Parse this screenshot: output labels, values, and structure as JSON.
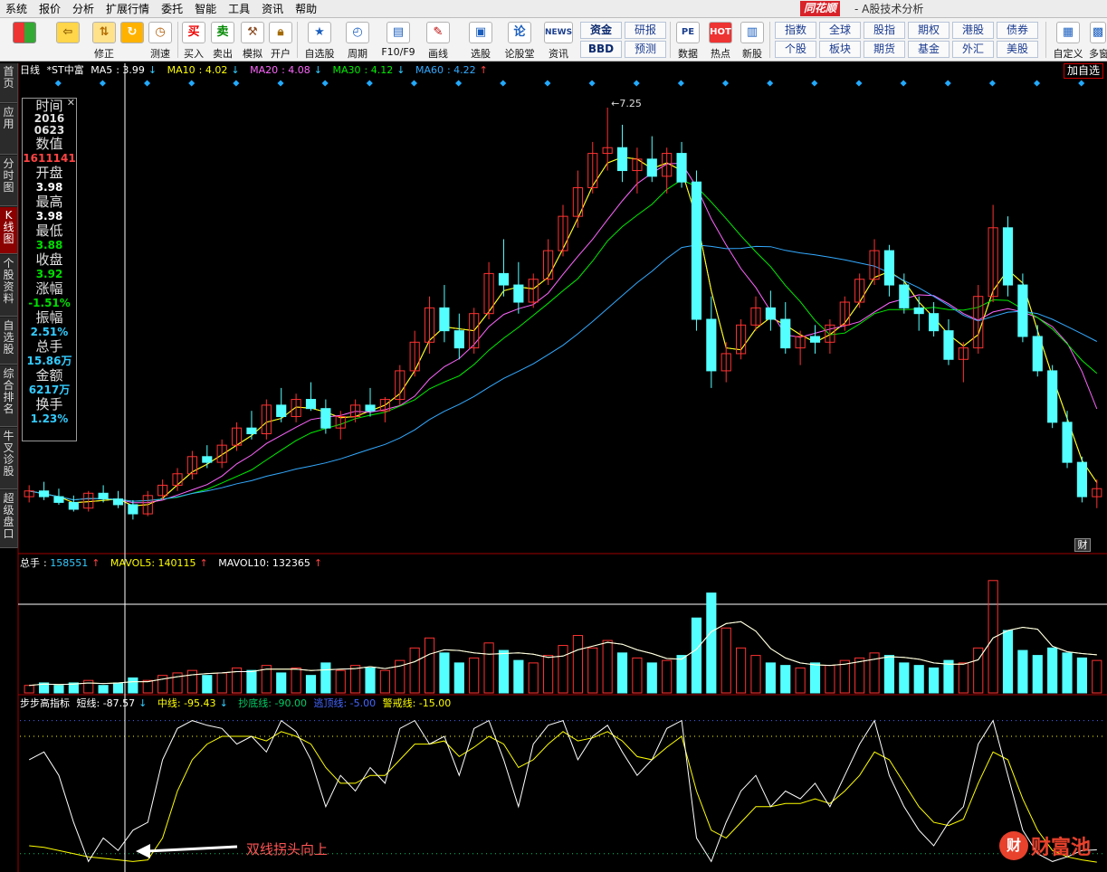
{
  "menubar": {
    "items": [
      "系统",
      "报价",
      "分析",
      "扩展行情",
      "委托",
      "智能",
      "工具",
      "资讯",
      "帮助"
    ],
    "logo": "同花顺",
    "title": "- A股技术分析"
  },
  "toolbar": {
    "buttons": [
      {
        "label": "",
        "icon": "grid-icon"
      },
      {
        "label": "",
        "icon": "back-arrow-icon"
      },
      {
        "label": "修正",
        "icon": "up-down-arrows-icon"
      },
      {
        "label": "测速",
        "icon": "speedometer-icon"
      },
      {
        "label": "买入",
        "icon": "buy-icon",
        "glyph": "买"
      },
      {
        "label": "卖出",
        "icon": "sell-icon",
        "glyph": "卖"
      },
      {
        "label": "模拟",
        "icon": "hammer-icon"
      },
      {
        "label": "开户",
        "icon": "lock-icon"
      },
      {
        "label": "自选股",
        "icon": "star-icon"
      },
      {
        "label": "周期",
        "icon": "clock-icon"
      },
      {
        "label": "F10/F9",
        "icon": "f10-icon"
      },
      {
        "label": "画线",
        "icon": "pen-icon"
      },
      {
        "label": "选股",
        "icon": "select-stock-icon"
      },
      {
        "label": "论股堂",
        "icon": "forum-icon"
      },
      {
        "label": "资讯",
        "icon": "news-icon",
        "glyph": "NEWS"
      },
      {
        "label": "数据",
        "icon": "pe-icon",
        "glyph": "PE"
      },
      {
        "label": "热点",
        "icon": "hot-icon"
      },
      {
        "label": "新股",
        "icon": "new-stock-icon"
      },
      {
        "label": "自定义",
        "icon": "custom-icon"
      },
      {
        "label": "多窗",
        "icon": "multi-window-icon"
      }
    ],
    "grid": [
      [
        "资金",
        "研报"
      ],
      [
        "BBD",
        "预测"
      ],
      [
        "指数",
        "全球",
        "股指",
        "期权",
        "港股",
        "债券"
      ],
      [
        "个股",
        "板块",
        "期货",
        "基金",
        "外汇",
        "美股"
      ]
    ]
  },
  "left_tabs": [
    "首页",
    "应用",
    "分时图",
    "K线图",
    "个股资料",
    "自选股",
    "综合排名",
    "牛叉诊股",
    "超级盘口"
  ],
  "legend": {
    "period": "日线",
    "stock": "*ST中富",
    "ma": [
      {
        "name": "MA5",
        "value": "3.99",
        "arrow": "↓",
        "color": "#ffffff"
      },
      {
        "name": "MA10",
        "value": "4.02",
        "arrow": "↓",
        "color": "#ffff00"
      },
      {
        "name": "MA20",
        "value": "4.08",
        "arrow": "↓",
        "color": "#ff66ff"
      },
      {
        "name": "MA30",
        "value": "4.12",
        "arrow": "↓",
        "color": "#00ee00"
      },
      {
        "name": "MA60",
        "value": "4.22",
        "arrow": "↑",
        "color": "#33aaff"
      }
    ],
    "add_watch": "加自选",
    "high_label": "7.25"
  },
  "volume_legend": {
    "label": "总手",
    "value": "158551",
    "mavol5": "MAVOL5: 140115",
    "mavol10": "MAVOL10: 132365"
  },
  "indicator_legend": {
    "name": "步步高指标",
    "short": "短线: -87.57",
    "mid": "中线: -95.43",
    "buy": "抄底线: -90.00",
    "escape": "逃顶线: -5.00",
    "warn": "警戒线: -15.00"
  },
  "data_panel": [
    {
      "label": "时间",
      "value": "2016",
      "value2": "0623",
      "color": "#e0e0e0"
    },
    {
      "label": "数值",
      "value": "1611141",
      "color": "#ff4444"
    },
    {
      "label": "开盘",
      "value": "3.98",
      "color": "#ffffff"
    },
    {
      "label": "最高",
      "value": "3.98",
      "color": "#ffffff"
    },
    {
      "label": "最低",
      "value": "3.88",
      "color": "#00dd00"
    },
    {
      "label": "收盘",
      "value": "3.92",
      "color": "#00dd00"
    },
    {
      "label": "涨幅",
      "value": "-1.51%",
      "color": "#00dd00"
    },
    {
      "label": "振幅",
      "value": "2.51%",
      "color": "#33ccff"
    },
    {
      "label": "总手",
      "value": "15.86万",
      "color": "#33ccff"
    },
    {
      "label": "金额",
      "value": "6217万",
      "color": "#33ccff"
    },
    {
      "label": "换手",
      "value": "1.23%",
      "color": "#33ccff"
    }
  ],
  "annotation": "双线拐头向上",
  "cai_badge": "财",
  "watermark": {
    "badge": "财",
    "text": "财富池"
  },
  "chart_data": {
    "type": "candlestick",
    "title": "*ST中富 日线",
    "price_range": [
      3.4,
      7.4
    ],
    "max_price_label": 7.25,
    "candles": [
      [
        3.85,
        3.95,
        3.8,
        3.9
      ],
      [
        3.9,
        3.98,
        3.82,
        3.85
      ],
      [
        3.85,
        3.92,
        3.78,
        3.8
      ],
      [
        3.8,
        3.86,
        3.72,
        3.74
      ],
      [
        3.75,
        3.9,
        3.72,
        3.88
      ],
      [
        3.88,
        3.95,
        3.8,
        3.83
      ],
      [
        3.83,
        3.9,
        3.75,
        3.78
      ],
      [
        3.78,
        3.82,
        3.65,
        3.7
      ],
      [
        3.7,
        3.9,
        3.68,
        3.86
      ],
      [
        3.86,
        4.0,
        3.82,
        3.95
      ],
      [
        3.95,
        4.1,
        3.9,
        4.05
      ],
      [
        4.05,
        4.25,
        4.0,
        4.2
      ],
      [
        4.2,
        4.3,
        4.1,
        4.15
      ],
      [
        4.15,
        4.35,
        4.1,
        4.3
      ],
      [
        4.3,
        4.5,
        4.25,
        4.45
      ],
      [
        4.45,
        4.6,
        4.35,
        4.4
      ],
      [
        4.4,
        4.7,
        4.35,
        4.65
      ],
      [
        4.65,
        4.8,
        4.5,
        4.55
      ],
      [
        4.55,
        4.75,
        4.5,
        4.7
      ],
      [
        4.7,
        4.85,
        4.6,
        4.62
      ],
      [
        4.62,
        4.7,
        4.4,
        4.45
      ],
      [
        4.45,
        4.6,
        4.35,
        4.55
      ],
      [
        4.55,
        4.7,
        4.5,
        4.65
      ],
      [
        4.65,
        4.8,
        4.55,
        4.6
      ],
      [
        4.6,
        4.72,
        4.5,
        4.7
      ],
      [
        4.7,
        5.0,
        4.65,
        4.95
      ],
      [
        4.95,
        5.3,
        4.9,
        5.2
      ],
      [
        5.2,
        5.6,
        5.1,
        5.5
      ],
      [
        5.5,
        5.7,
        5.2,
        5.3
      ],
      [
        5.3,
        5.45,
        5.05,
        5.15
      ],
      [
        5.15,
        5.5,
        5.1,
        5.45
      ],
      [
        5.45,
        5.9,
        5.4,
        5.8
      ],
      [
        5.8,
        6.1,
        5.6,
        5.7
      ],
      [
        5.7,
        5.9,
        5.45,
        5.55
      ],
      [
        5.55,
        5.8,
        5.5,
        5.75
      ],
      [
        5.75,
        6.1,
        5.7,
        6.0
      ],
      [
        6.0,
        6.4,
        5.95,
        6.3
      ],
      [
        6.3,
        6.7,
        6.2,
        6.55
      ],
      [
        6.55,
        6.95,
        6.5,
        6.85
      ],
      [
        6.85,
        7.25,
        6.7,
        6.9
      ],
      [
        6.9,
        7.1,
        6.6,
        6.7
      ],
      [
        6.7,
        6.9,
        6.5,
        6.8
      ],
      [
        6.8,
        7.0,
        6.6,
        6.65
      ],
      [
        6.65,
        6.9,
        6.5,
        6.85
      ],
      [
        6.85,
        6.95,
        6.55,
        6.6
      ],
      [
        6.6,
        6.7,
        5.3,
        5.4
      ],
      [
        5.4,
        5.6,
        4.8,
        4.95
      ],
      [
        4.95,
        5.2,
        4.85,
        5.1
      ],
      [
        5.1,
        5.4,
        5.05,
        5.35
      ],
      [
        5.35,
        5.6,
        5.3,
        5.5
      ],
      [
        5.5,
        5.65,
        5.3,
        5.4
      ],
      [
        5.4,
        5.55,
        5.1,
        5.15
      ],
      [
        5.15,
        5.3,
        5.0,
        5.25
      ],
      [
        5.25,
        5.35,
        5.1,
        5.2
      ],
      [
        5.2,
        5.4,
        5.1,
        5.35
      ],
      [
        5.35,
        5.6,
        5.3,
        5.55
      ],
      [
        5.55,
        5.8,
        5.5,
        5.75
      ],
      [
        5.75,
        6.1,
        5.7,
        6.0
      ],
      [
        6.0,
        6.05,
        5.6,
        5.7
      ],
      [
        5.7,
        5.8,
        5.45,
        5.5
      ],
      [
        5.5,
        5.6,
        5.3,
        5.45
      ],
      [
        5.45,
        5.55,
        5.25,
        5.3
      ],
      [
        5.3,
        5.4,
        5.0,
        5.05
      ],
      [
        5.05,
        5.2,
        4.85,
        5.15
      ],
      [
        5.15,
        5.7,
        5.1,
        5.6
      ],
      [
        5.6,
        6.4,
        5.55,
        6.2
      ],
      [
        6.2,
        6.3,
        5.6,
        5.7
      ],
      [
        5.7,
        5.8,
        5.2,
        5.25
      ],
      [
        5.25,
        5.35,
        4.9,
        4.95
      ],
      [
        4.95,
        5.0,
        4.45,
        4.5
      ],
      [
        4.5,
        4.6,
        4.1,
        4.15
      ],
      [
        4.15,
        4.2,
        3.8,
        3.85
      ],
      [
        3.85,
        4.0,
        3.75,
        3.92
      ]
    ],
    "ma_series": [
      "MA5",
      "MA10",
      "MA20",
      "MA30",
      "MA60"
    ],
    "volume": [
      3,
      4,
      3,
      4,
      5,
      3,
      4,
      6,
      5,
      7,
      8,
      9,
      7,
      8,
      10,
      9,
      11,
      8,
      10,
      7,
      12,
      9,
      11,
      10,
      9,
      13,
      18,
      22,
      16,
      12,
      14,
      20,
      17,
      13,
      12,
      15,
      19,
      23,
      18,
      21,
      16,
      14,
      12,
      13,
      15,
      30,
      40,
      26,
      18,
      15,
      12,
      11,
      10,
      12,
      11,
      13,
      14,
      16,
      15,
      12,
      11,
      10,
      13,
      12,
      18,
      45,
      25,
      17,
      15,
      18,
      16,
      14,
      13
    ],
    "volume_range": [
      0,
      50
    ],
    "indicator_range": [
      -100,
      0
    ],
    "indicator_short": [
      -30,
      -25,
      -40,
      -70,
      -95,
      -80,
      -88,
      -75,
      -70,
      -30,
      -10,
      -5,
      -8,
      -10,
      -20,
      -15,
      -25,
      -5,
      -12,
      -30,
      -60,
      -40,
      -50,
      -35,
      -45,
      -10,
      -5,
      -20,
      -15,
      -40,
      -10,
      -5,
      -30,
      -60,
      -20,
      -8,
      -5,
      -30,
      -15,
      -8,
      -25,
      -40,
      -30,
      -10,
      -5,
      -80,
      -95,
      -70,
      -50,
      -40,
      -60,
      -50,
      -55,
      -45,
      -60,
      -40,
      -20,
      -5,
      -40,
      -60,
      -75,
      -85,
      -70,
      -60,
      -20,
      -5,
      -40,
      -75,
      -90,
      -95,
      -92,
      -88,
      -87.57
    ],
    "indicator_mid": [
      -85,
      -86,
      -88,
      -90,
      -92,
      -93,
      -94,
      -95,
      -94,
      -80,
      -50,
      -30,
      -20,
      -15,
      -15,
      -15,
      -18,
      -12,
      -15,
      -20,
      -35,
      -45,
      -45,
      -40,
      -40,
      -30,
      -20,
      -20,
      -18,
      -28,
      -22,
      -15,
      -20,
      -35,
      -30,
      -20,
      -12,
      -18,
      -16,
      -12,
      -18,
      -28,
      -30,
      -22,
      -15,
      -50,
      -75,
      -80,
      -70,
      -60,
      -60,
      -58,
      -58,
      -55,
      -58,
      -50,
      -40,
      -25,
      -30,
      -45,
      -60,
      -70,
      -72,
      -68,
      -45,
      -25,
      -30,
      -55,
      -75,
      -88,
      -92,
      -94,
      -95.43
    ]
  }
}
